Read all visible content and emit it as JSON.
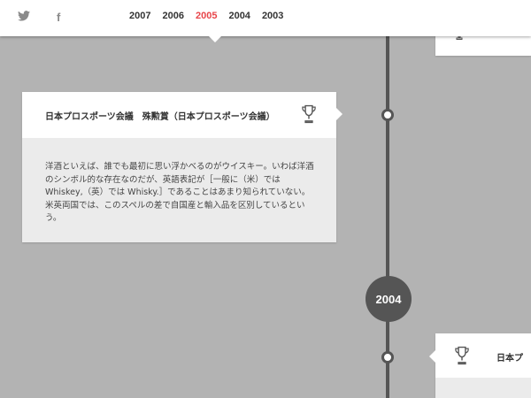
{
  "social": {
    "twitter_icon": "twitter-icon",
    "facebook_glyph": "f"
  },
  "nav": {
    "years": [
      "2007",
      "2006",
      "2005",
      "2004",
      "2003"
    ],
    "active_year": "2005"
  },
  "timeline": {
    "year_marker": "2004"
  },
  "card_main": {
    "title": "日本プロスポーツ会議　殊勲賞（日本プロスポーツ会議）",
    "icon": "trophy-icon",
    "body_lines": [
      "洋酒といえば、誰でも最初に思い浮かべるのがウイスキー。いわば洋酒",
      "のシンボル的な存在なのだが、英語表記が［一般に（米）では",
      "Whiskey,（英）では Whisky.］であることはあまり知られていない。",
      "米英両国では、このスペルの差で自国産と輸入品を区別しているとい",
      "う。"
    ]
  },
  "card_bottom_right": {
    "title": "日本プ",
    "icon": "trophy-icon"
  },
  "colors": {
    "background": "#b3b3b3",
    "accent": "#e8454a",
    "timeline": "#555555",
    "card": "#ffffff",
    "card_body": "#ebebeb"
  }
}
